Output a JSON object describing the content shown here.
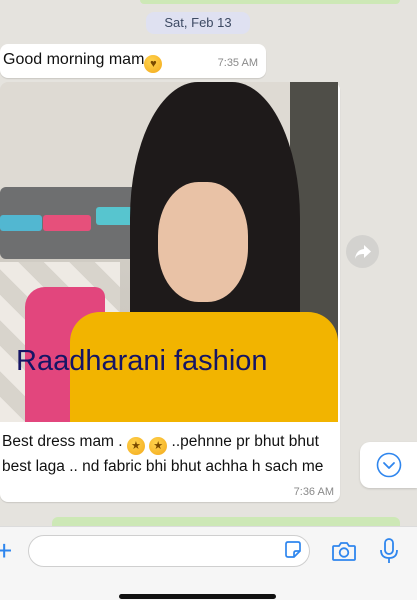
{
  "date_separator": "Sat, Feb 13",
  "messages": [
    {
      "text": "Good morning mam",
      "time": "7:35 AM"
    },
    {
      "image_watermark": "Raadharani fashion",
      "caption_parts": [
        "Best dress mam .",
        "..pehnne pr bhut bhut best laga .. nd fabric bhi bhut achha h sach me"
      ],
      "time": "7:36 AM"
    }
  ],
  "input": {
    "placeholder": ""
  },
  "icons": [
    "smiling-hearts-emoji-icon",
    "star-struck-emoji-icon",
    "forward-icon",
    "scroll-down-icon",
    "plus-icon",
    "sticker-icon",
    "camera-icon",
    "microphone-icon"
  ],
  "colors": {
    "accent": "#2f86ee",
    "sent_bubble": "#cde8b6",
    "received_bubble": "#ffffff",
    "background": "#e5e3de"
  }
}
